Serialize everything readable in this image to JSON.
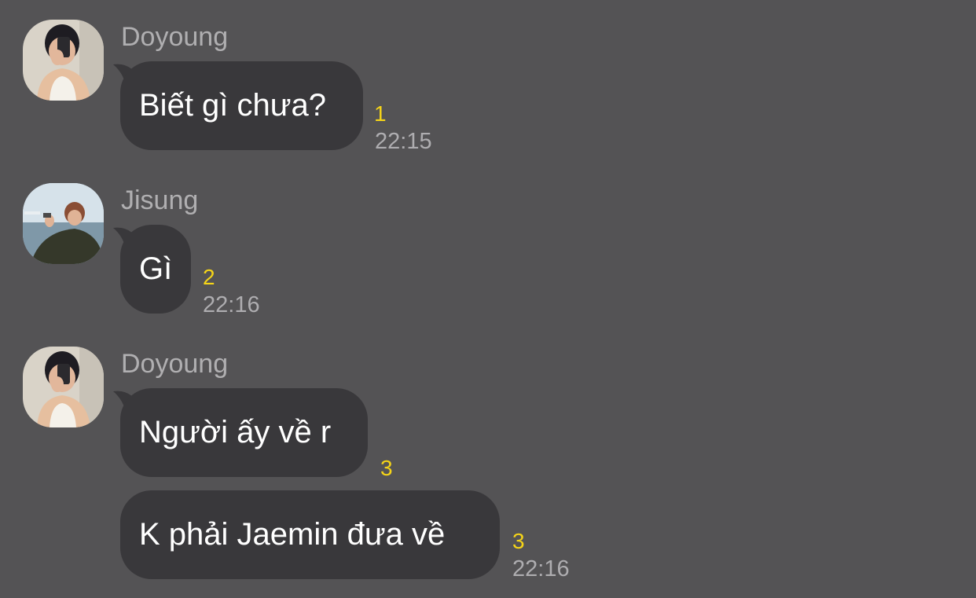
{
  "colors": {
    "background": "#545355",
    "bubble": "#39383b",
    "message_text": "#ffffff",
    "sender_name": "#b0afb1",
    "unread_count": "#f5d418",
    "timestamp": "#aeadb0"
  },
  "messages": [
    {
      "sender": "Doyoung",
      "avatar": "avatar-doyoung",
      "bubbles": [
        {
          "text": "Biết gì chưa?",
          "unread": "1",
          "time": "22:15"
        }
      ]
    },
    {
      "sender": "Jisung",
      "avatar": "avatar-jisung",
      "bubbles": [
        {
          "text": "Gì",
          "unread": "2",
          "time": "22:16"
        }
      ]
    },
    {
      "sender": "Doyoung",
      "avatar": "avatar-doyoung",
      "bubbles": [
        {
          "text": "Người ấy về r",
          "unread": "3",
          "time": ""
        },
        {
          "text": "K phải Jaemin đưa về",
          "unread": "3",
          "time": "22:16"
        }
      ]
    }
  ]
}
